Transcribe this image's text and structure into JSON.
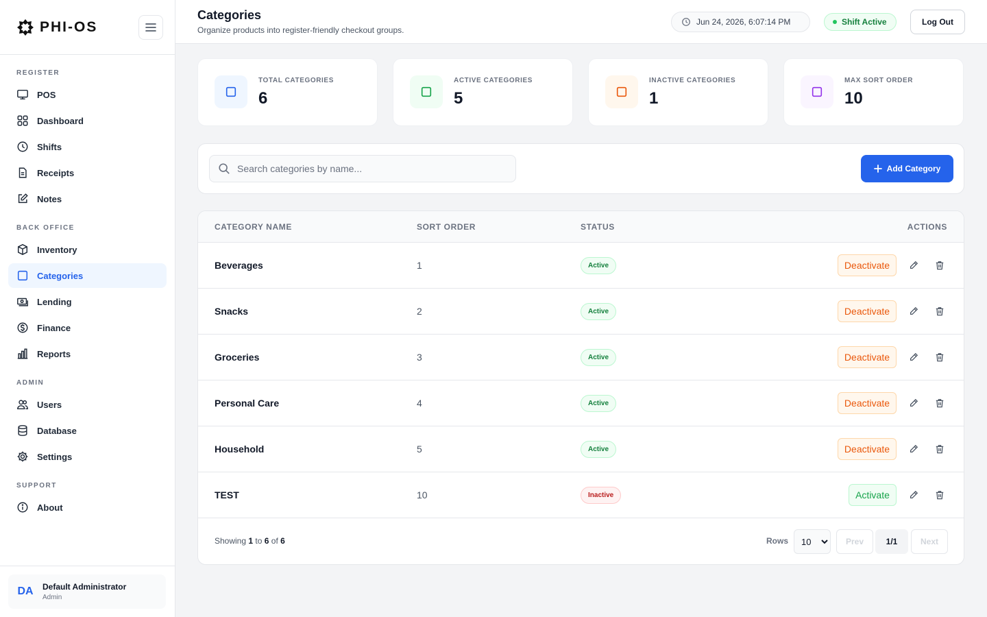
{
  "brand": {
    "name": "PHI-OS"
  },
  "sidebar": {
    "sections": [
      {
        "title": "REGISTER",
        "items": [
          {
            "label": "POS",
            "icon": "monitor-icon"
          },
          {
            "label": "Dashboard",
            "icon": "dashboard-icon"
          },
          {
            "label": "Shifts",
            "icon": "clock-icon"
          },
          {
            "label": "Receipts",
            "icon": "receipt-icon"
          },
          {
            "label": "Notes",
            "icon": "edit-note-icon"
          }
        ]
      },
      {
        "title": "BACK OFFICE",
        "items": [
          {
            "label": "Inventory",
            "icon": "box-icon"
          },
          {
            "label": "Categories",
            "icon": "square-icon",
            "active": true
          },
          {
            "label": "Lending",
            "icon": "cash-icon"
          },
          {
            "label": "Finance",
            "icon": "dollar-icon"
          },
          {
            "label": "Reports",
            "icon": "bar-chart-icon"
          }
        ]
      },
      {
        "title": "ADMIN",
        "items": [
          {
            "label": "Users",
            "icon": "users-icon"
          },
          {
            "label": "Database",
            "icon": "database-icon"
          },
          {
            "label": "Settings",
            "icon": "gear-icon"
          }
        ]
      },
      {
        "title": "SUPPORT",
        "items": [
          {
            "label": "About",
            "icon": "info-icon"
          }
        ]
      }
    ]
  },
  "user": {
    "initials": "DA",
    "name": "Default Administrator",
    "role": "Admin"
  },
  "header": {
    "title": "Categories",
    "subtitle": "Organize products into register-friendly checkout groups.",
    "datetime": "Jun 24, 2026, 6:07:14 PM",
    "shift_status": "Shift Active",
    "logout_label": "Log Out"
  },
  "stats": [
    {
      "label": "TOTAL CATEGORIES",
      "value": "6",
      "color": "#2563eb",
      "bg": "#eff6ff"
    },
    {
      "label": "ACTIVE CATEGORIES",
      "value": "5",
      "color": "#16a34a",
      "bg": "#f0fdf4"
    },
    {
      "label": "INACTIVE CATEGORIES",
      "value": "1",
      "color": "#ea580c",
      "bg": "#fff7ed"
    },
    {
      "label": "MAX SORT ORDER",
      "value": "10",
      "color": "#9333ea",
      "bg": "#faf5ff"
    }
  ],
  "toolbar": {
    "search_placeholder": "Search categories by name...",
    "add_label": "Add Category"
  },
  "table": {
    "headers": [
      "CATEGORY NAME",
      "SORT ORDER",
      "STATUS",
      "ACTIONS"
    ],
    "rows": [
      {
        "name": "Beverages",
        "sort": "1",
        "status": "Active",
        "action": "Deactivate"
      },
      {
        "name": "Snacks",
        "sort": "2",
        "status": "Active",
        "action": "Deactivate"
      },
      {
        "name": "Groceries",
        "sort": "3",
        "status": "Active",
        "action": "Deactivate"
      },
      {
        "name": "Personal Care",
        "sort": "4",
        "status": "Active",
        "action": "Deactivate"
      },
      {
        "name": "Household",
        "sort": "5",
        "status": "Active",
        "action": "Deactivate"
      },
      {
        "name": "TEST",
        "sort": "10",
        "status": "Inactive",
        "action": "Activate"
      }
    ]
  },
  "pagination": {
    "showing_prefix": "Showing",
    "from": "1",
    "to_word": "to",
    "to": "6",
    "of_word": "of",
    "total": "6",
    "rows_label": "Rows",
    "rows_value": "10",
    "prev_label": "Prev",
    "page_label": "1/1",
    "next_label": "Next"
  }
}
